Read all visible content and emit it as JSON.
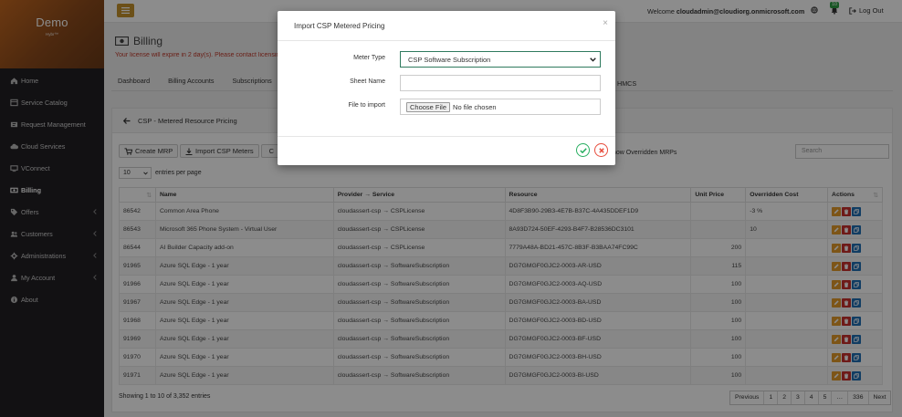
{
  "app": {
    "title": "Demo",
    "subtitle": "Hybr™"
  },
  "sidebar": {
    "items": [
      {
        "label": "Home",
        "icon": "home-icon",
        "chevron": false,
        "active": false
      },
      {
        "label": "Service Catalog",
        "icon": "catalog-icon",
        "chevron": false,
        "active": false
      },
      {
        "label": "Request Management",
        "icon": "ticket-icon",
        "chevron": false,
        "active": false
      },
      {
        "label": "Cloud Services",
        "icon": "cloud-icon",
        "chevron": false,
        "active": false
      },
      {
        "label": "VConnect",
        "icon": "vconnect-icon",
        "chevron": false,
        "active": false
      },
      {
        "label": "Billing",
        "icon": "billing-icon",
        "chevron": false,
        "active": true
      },
      {
        "label": "Offers",
        "icon": "offers-icon",
        "chevron": true,
        "active": false
      },
      {
        "label": "Customers",
        "icon": "customers-icon",
        "chevron": true,
        "active": false
      },
      {
        "label": "Administrations",
        "icon": "administrations-icon",
        "chevron": true,
        "active": false
      },
      {
        "label": "My Account",
        "icon": "account-icon",
        "chevron": true,
        "active": false
      },
      {
        "label": "About",
        "icon": "info-icon",
        "chevron": false,
        "active": false
      }
    ]
  },
  "topbar": {
    "welcome_prefix": "Welcome",
    "user": "cloudadmin@cloudiorg.onmicrosoft.com",
    "notifications": "10",
    "logout": "Log Out"
  },
  "page": {
    "title": "Billing",
    "license_notice": "Your license will expire in 2 day(s). Please contact licensing"
  },
  "tabs": [
    "Dashboard",
    "Billing Accounts",
    "Subscriptions"
  ],
  "tab_partial": "HMCS",
  "panel": {
    "title": "CSP - Metered Resource Pricing",
    "create_btn": "Create MRP",
    "import_btn": "Import CSP Meters",
    "third_btn": "C",
    "show_overridden": "how Overridden MRPs",
    "search_placeholder": "Search",
    "page_length": "10",
    "entries_label": "entries per page",
    "columns": [
      "",
      "Name",
      "Provider → Service",
      "Resource",
      "Unit Price",
      "Overridden Cost",
      "Actions"
    ],
    "rows": [
      {
        "id": "86542",
        "name": "Common Area Phone",
        "provider": "cloudassert-csp → CSPLicense",
        "resource": "4D8F3B90-29B3-4E7B-B37C-4A435DDEF1D9",
        "price": "",
        "ocost": "-3 %"
      },
      {
        "id": "86543",
        "name": "Microsoft 365 Phone System - Virtual User",
        "provider": "cloudassert-csp → CSPLicense",
        "resource": "8A93D724-50EF-4293-B4F7-B28536DC3101",
        "price": "",
        "ocost": "10"
      },
      {
        "id": "86544",
        "name": "AI Builder Capacity add-on",
        "provider": "cloudassert-csp → CSPLicense",
        "resource": "7779A48A-BD21-457C-8B3F-B3BAA74FC99C",
        "price": "200",
        "ocost": ""
      },
      {
        "id": "91965",
        "name": "Azure SQL Edge - 1 year",
        "provider": "cloudassert-csp → SoftwareSubscription",
        "resource": "DG7GMGF0GJC2-0003-AR-USD",
        "price": "115",
        "ocost": ""
      },
      {
        "id": "91966",
        "name": "Azure SQL Edge - 1 year",
        "provider": "cloudassert-csp → SoftwareSubscription",
        "resource": "DG7GMGF0GJC2-0003-AQ-USD",
        "price": "100",
        "ocost": ""
      },
      {
        "id": "91967",
        "name": "Azure SQL Edge - 1 year",
        "provider": "cloudassert-csp → SoftwareSubscription",
        "resource": "DG7GMGF0GJC2-0003-BA-USD",
        "price": "100",
        "ocost": ""
      },
      {
        "id": "91968",
        "name": "Azure SQL Edge - 1 year",
        "provider": "cloudassert-csp → SoftwareSubscription",
        "resource": "DG7GMGF0GJC2-0003-BD-USD",
        "price": "100",
        "ocost": ""
      },
      {
        "id": "91969",
        "name": "Azure SQL Edge - 1 year",
        "provider": "cloudassert-csp → SoftwareSubscription",
        "resource": "DG7GMGF0GJC2-0003-BF-USD",
        "price": "100",
        "ocost": ""
      },
      {
        "id": "91970",
        "name": "Azure SQL Edge - 1 year",
        "provider": "cloudassert-csp → SoftwareSubscription",
        "resource": "DG7GMGF0GJC2-0003-BH-USD",
        "price": "100",
        "ocost": ""
      },
      {
        "id": "91971",
        "name": "Azure SQL Edge - 1 year",
        "provider": "cloudassert-csp → SoftwareSubscription",
        "resource": "DG7GMGF0GJC2-0003-BI-USD",
        "price": "100",
        "ocost": ""
      }
    ],
    "info": "Showing 1 to 10 of 3,352 entries",
    "pager": [
      "Previous",
      "1",
      "2",
      "3",
      "4",
      "5",
      "…",
      "336",
      "Next"
    ]
  },
  "modal": {
    "title": "Import CSP Metered Pricing",
    "close": "×",
    "meter_label": "Meter Type",
    "meter_value": "CSP Software Subscription",
    "sheet_label": "Sheet Name",
    "sheet_value": "",
    "file_label": "File to import",
    "choose_label": "Choose File",
    "file_value": "No file chosen"
  },
  "colors": {
    "sidebar": "#211f24",
    "brand_orange": "#c46820",
    "hamburger": "#c5932c",
    "notice_red": "#c0392b",
    "confirm_green": "#27ae60",
    "cancel_red": "#e74c3c",
    "edit": "#e39b2b",
    "delete": "#c9302c",
    "copy": "#1f6fb5"
  }
}
